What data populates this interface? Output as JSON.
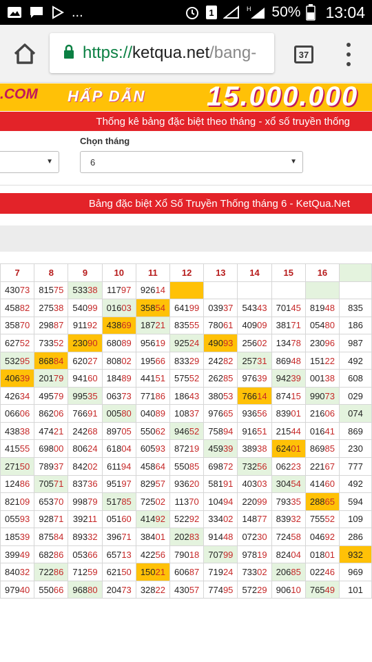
{
  "status_bar": {
    "battery": "50%",
    "time": "13:04",
    "overflow": "...",
    "alarm_icon": "alarm-icon",
    "sim_badge": "1",
    "network_type": "H"
  },
  "browser": {
    "url_scheme": "https://",
    "url_host": "ketqua.net",
    "url_path": "/bang-",
    "tab_count": "37"
  },
  "banner": {
    "left_text": ".COM",
    "middle_text": "HẤP DẪN",
    "amount_text": "15.000.000"
  },
  "header_bar": {
    "text": "Thống kê bảng đặc biệt theo tháng - xổ số truyền thống"
  },
  "form": {
    "month_label": "Chọn tháng",
    "month_value": "6",
    "left_select_value": ""
  },
  "table_title": {
    "text": "Bảng đặc biệt Xổ Số Truyền Thống tháng 6 - KetQua.Net"
  },
  "table": {
    "columns": [
      "7",
      "8",
      "9",
      "10",
      "11",
      "12",
      "13",
      "14",
      "15",
      "16",
      ""
    ],
    "rows": [
      [
        "43073",
        "81575",
        "53338",
        "11797",
        "92614",
        "",
        "",
        "",
        "",
        "",
        ""
      ],
      [
        "45882",
        "27538",
        "54099",
        "01603",
        "35854",
        "64199",
        "03937",
        "54343",
        "70145",
        "81948",
        "835"
      ],
      [
        "35870",
        "29887",
        "91192",
        "43869",
        "18721",
        "83555",
        "78061",
        "40909",
        "38171",
        "05480",
        "186"
      ],
      [
        "62752",
        "73352",
        "23090",
        "68089",
        "95619",
        "92524",
        "49093",
        "25602",
        "13478",
        "23096",
        "987"
      ],
      [
        "53295",
        "86884",
        "62027",
        "80802",
        "19566",
        "83329",
        "24282",
        "25731",
        "86948",
        "15122",
        "492"
      ],
      [
        "40639",
        "20179",
        "94160",
        "18489",
        "44151",
        "57552",
        "26285",
        "97639",
        "94239",
        "00138",
        "608"
      ],
      [
        "42634",
        "49579",
        "99535",
        "06373",
        "77186",
        "18643",
        "38053",
        "76614",
        "87415",
        "99073",
        "029"
      ],
      [
        "06606",
        "86206",
        "76691",
        "00580",
        "04089",
        "10837",
        "97665",
        "93656",
        "83901",
        "21606",
        "074"
      ],
      [
        "43838",
        "47421",
        "24268",
        "89705",
        "55062",
        "94652",
        "75894",
        "91651",
        "21544",
        "01641",
        "869"
      ],
      [
        "41555",
        "69800",
        "80624",
        "61804",
        "60593",
        "87219",
        "45939",
        "38938",
        "62401",
        "86985",
        "230"
      ],
      [
        "27150",
        "78937",
        "84202",
        "61194",
        "45864",
        "55085",
        "69872",
        "73256",
        "06223",
        "22167",
        "777"
      ],
      [
        "12486",
        "70571",
        "83736",
        "95197",
        "82957",
        "93620",
        "58191",
        "40303",
        "30454",
        "41460",
        "492"
      ],
      [
        "82109",
        "65370",
        "99879",
        "51785",
        "72502",
        "11370",
        "10494",
        "22099",
        "79335",
        "28865",
        "594"
      ],
      [
        "05593",
        "92871",
        "39211",
        "05160",
        "41492",
        "52292",
        "33402",
        "14877",
        "83932",
        "75552",
        "109"
      ],
      [
        "18539",
        "87584",
        "89332",
        "39671",
        "38401",
        "20283",
        "91448",
        "07230",
        "72458",
        "04692",
        "286"
      ],
      [
        "39949",
        "68286",
        "05366",
        "65713",
        "42256",
        "79018",
        "70799",
        "97819",
        "82404",
        "01801",
        "932"
      ],
      [
        "84032",
        "72286",
        "71259",
        "62150",
        "15021",
        "60687",
        "71924",
        "73302",
        "20685",
        "02246",
        "969"
      ],
      [
        "97940",
        "55066",
        "96880",
        "20473",
        "32822",
        "43057",
        "77495",
        "57229",
        "90610",
        "76549",
        "101"
      ]
    ],
    "highlights": [
      [
        "",
        "",
        "g",
        "",
        "",
        "y",
        "",
        "",
        "",
        "g",
        ""
      ],
      [
        "",
        "",
        "",
        "g",
        "y",
        "",
        "",
        "",
        "",
        "",
        ""
      ],
      [
        "",
        "",
        "",
        "y",
        "g",
        "",
        "",
        "",
        "",
        "",
        ""
      ],
      [
        "",
        "",
        "y",
        "",
        "",
        "g",
        "y",
        "",
        "",
        "",
        ""
      ],
      [
        "g",
        "y",
        "",
        "",
        "",
        "",
        "",
        "g",
        "",
        "",
        ""
      ],
      [
        "y",
        "g",
        "",
        "",
        "",
        "",
        "",
        "",
        "g",
        "",
        ""
      ],
      [
        "",
        "",
        "g",
        "",
        "",
        "",
        "",
        "y",
        "",
        "g",
        ""
      ],
      [
        "",
        "",
        "",
        "g",
        "",
        "",
        "",
        "",
        "",
        "",
        "g"
      ],
      [
        "",
        "",
        "",
        "",
        "",
        "g",
        "",
        "",
        "",
        "",
        ""
      ],
      [
        "",
        "",
        "",
        "",
        "",
        "",
        "g",
        "",
        "y",
        "",
        ""
      ],
      [
        "g",
        "",
        "",
        "",
        "",
        "",
        "",
        "g",
        "",
        "",
        ""
      ],
      [
        "",
        "g",
        "",
        "",
        "",
        "",
        "",
        "",
        "g",
        "",
        ""
      ],
      [
        "",
        "",
        "",
        "g",
        "",
        "",
        "",
        "",
        "",
        "y",
        ""
      ],
      [
        "",
        "",
        "",
        "",
        "g",
        "",
        "",
        "",
        "",
        "",
        ""
      ],
      [
        "",
        "",
        "",
        "",
        "",
        "g",
        "",
        "",
        "",
        "",
        ""
      ],
      [
        "",
        "",
        "",
        "",
        "",
        "",
        "g",
        "",
        "",
        "",
        "y"
      ],
      [
        "",
        "g",
        "",
        "",
        "y",
        "",
        "",
        "",
        "g",
        "",
        ""
      ],
      [
        "",
        "",
        "g",
        "",
        "",
        "",
        "",
        "",
        "",
        "g",
        ""
      ]
    ],
    "colors": {
      "yellow": "#ffc107",
      "green": "#e4f3de",
      "tail_red": "#c62828",
      "header_red": "#b71c1c"
    }
  }
}
